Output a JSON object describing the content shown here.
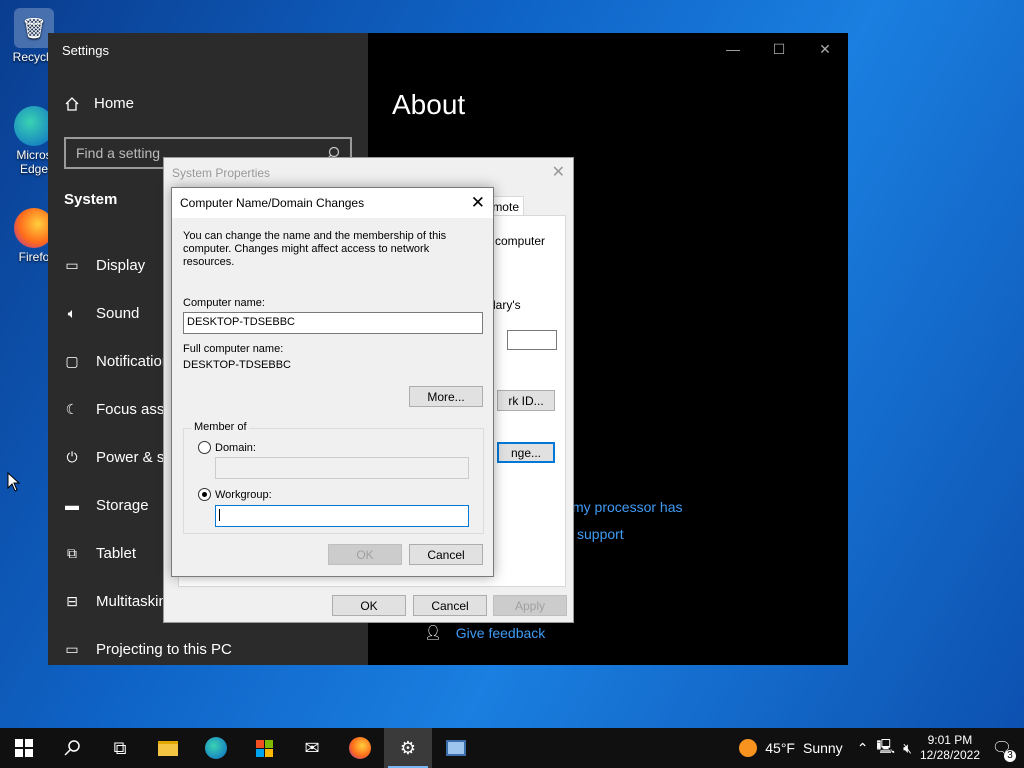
{
  "desktop": {
    "icons": [
      {
        "label": "Recycle",
        "icon": "recycle-bin-icon"
      },
      {
        "label": "Micros Edge",
        "icon": "edge-icon"
      },
      {
        "label": "Firefo",
        "icon": "firefox-icon"
      }
    ]
  },
  "settings": {
    "window_title": "Settings",
    "home_label": "Home",
    "search_placeholder": "Find a setting",
    "section": "System",
    "nav": [
      {
        "label": "Display",
        "icon": "display-icon"
      },
      {
        "label": "Sound",
        "icon": "sound-icon"
      },
      {
        "label": "Notification",
        "icon": "notification-icon"
      },
      {
        "label": "Focus assist",
        "icon": "moon-icon"
      },
      {
        "label": "Power & sle",
        "icon": "power-icon"
      },
      {
        "label": "Storage",
        "icon": "storage-icon"
      },
      {
        "label": "Tablet",
        "icon": "tablet-icon"
      },
      {
        "label": "Multitasking",
        "icon": "multitasking-icon"
      },
      {
        "label": "Projecting to this PC",
        "icon": "projecting-icon"
      }
    ],
    "page_title": "About",
    "links": {
      "processor": "my processor has",
      "support": "support",
      "feedback": "Give feedback"
    }
  },
  "system_properties": {
    "title": "System Properties",
    "tab_remote": "emote",
    "text_computer": "computer",
    "text_library": "lary's",
    "network_id_button": "rk ID...",
    "change_button": "nge...",
    "ok": "OK",
    "cancel": "Cancel",
    "apply": "Apply"
  },
  "computer_name_dialog": {
    "title": "Computer Name/Domain Changes",
    "description": "You can change the name and the membership of this computer. Changes might affect access to network resources.",
    "computer_name_label": "Computer name:",
    "computer_name_value": "DESKTOP-TDSEBBC",
    "full_name_label": "Full computer name:",
    "full_name_value": "DESKTOP-TDSEBBC",
    "more_button": "More...",
    "member_of_label": "Member of",
    "domain_label": "Domain:",
    "domain_value": "",
    "workgroup_label": "Workgroup:",
    "workgroup_value": "",
    "selected_membership": "Workgroup",
    "ok": "OK",
    "cancel": "Cancel"
  },
  "taskbar": {
    "weather_temp": "45°F",
    "weather_text": "Sunny",
    "time": "9:01 PM",
    "date": "12/28/2022",
    "notification_count": "3"
  }
}
